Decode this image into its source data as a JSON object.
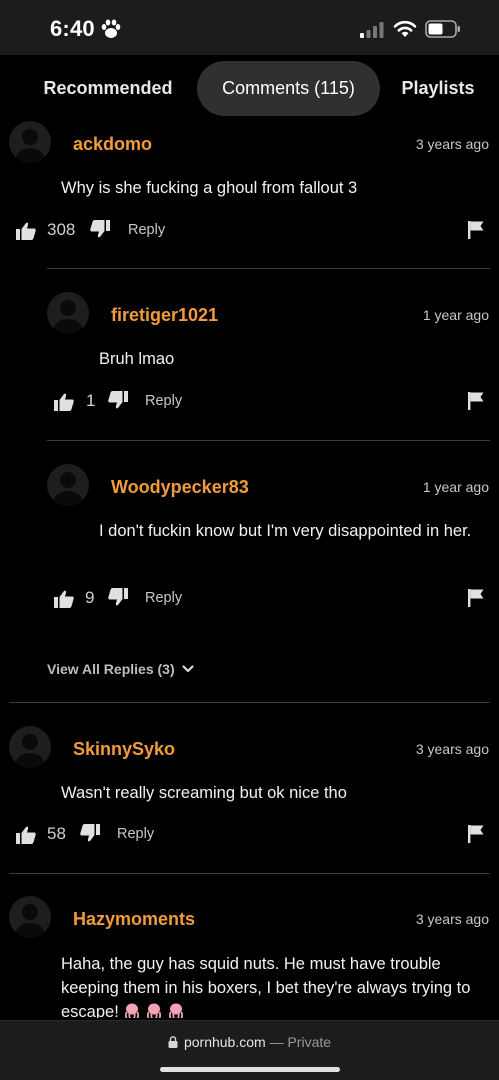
{
  "status_bar": {
    "time": "6:40"
  },
  "tabs": [
    {
      "label": "Recommended"
    },
    {
      "label": "Comments (115)"
    },
    {
      "label": "Playlists"
    }
  ],
  "comments": [
    {
      "username": "ackdomo",
      "time": "3 years ago",
      "text": "Why is she fucking a ghoul from fallout 3",
      "likes": "308",
      "reply_label": "Reply"
    },
    {
      "username": "firetiger1021",
      "time": "1 year ago",
      "text": "Bruh lmao",
      "likes": "1",
      "reply_label": "Reply"
    },
    {
      "username": "Woodypecker83",
      "time": "1 year ago",
      "text": "I don't fuckin know but I'm very disappointed in her.",
      "likes": "9",
      "reply_label": "Reply"
    },
    {
      "username": "SkinnySyko",
      "time": "3 years ago",
      "text": "Wasn't really screaming but ok nice tho",
      "likes": "58",
      "reply_label": "Reply"
    },
    {
      "username": "Hazymoments",
      "time": "3 years ago",
      "text": "Haha, the guy has squid nuts. He must have trouble keeping them in his boxers, I bet they're always trying to escape!",
      "emoji": "octopus-emoji"
    }
  ],
  "view_all_replies": "View All Replies (3)",
  "bottom_bar": {
    "url": "pornhub.com",
    "privacy": "— Private"
  },
  "colors": {
    "username": "#f19b3d",
    "background": "#000000",
    "active_tab": "#303030"
  }
}
